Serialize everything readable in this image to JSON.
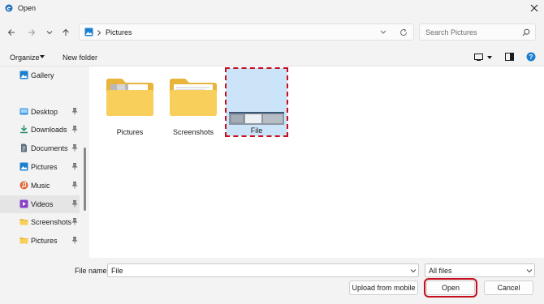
{
  "window": {
    "title": "Open",
    "app_icon": "edge-icon"
  },
  "nav": {
    "back_icon": "arrow-left-icon",
    "forward_icon": "arrow-right-icon",
    "recent_icon": "chevron-down-icon",
    "up_icon": "arrow-up-icon",
    "address_crumb": "Pictures",
    "refresh_icon": "refresh-icon",
    "search_placeholder": "Search Pictures"
  },
  "toolbar": {
    "organize_label": "Organize",
    "new_folder_label": "New folder"
  },
  "sidebar": {
    "items": [
      {
        "label": "Gallery",
        "icon": "gallery-icon",
        "pinned": false
      },
      {
        "label": "Desktop",
        "icon": "desktop-icon",
        "pinned": true
      },
      {
        "label": "Downloads",
        "icon": "download-icon",
        "pinned": true
      },
      {
        "label": "Documents",
        "icon": "documents-icon",
        "pinned": true
      },
      {
        "label": "Pictures",
        "icon": "pictures-icon",
        "pinned": true
      },
      {
        "label": "Music",
        "icon": "music-icon",
        "pinned": true
      },
      {
        "label": "Videos",
        "icon": "videos-icon",
        "pinned": true
      },
      {
        "label": "Screenshots",
        "icon": "folder-icon",
        "pinned": true
      },
      {
        "label": "Pictures",
        "icon": "folder-icon",
        "pinned": true
      }
    ],
    "selected": "Videos"
  },
  "content": {
    "items": [
      {
        "label": "Pictures",
        "type": "folder"
      },
      {
        "label": "Screenshots",
        "type": "folder"
      },
      {
        "label": "File",
        "type": "image",
        "selected": true
      }
    ]
  },
  "bottom": {
    "file_name_label": "File name:",
    "file_name_value": "File",
    "file_type_value": "All files",
    "upload_label": "Upload from mobile",
    "open_label": "Open",
    "cancel_label": "Cancel"
  },
  "colors": {
    "accent": "#0067c0",
    "highlight": "#c50f1f",
    "selection": "#cce4f7"
  }
}
